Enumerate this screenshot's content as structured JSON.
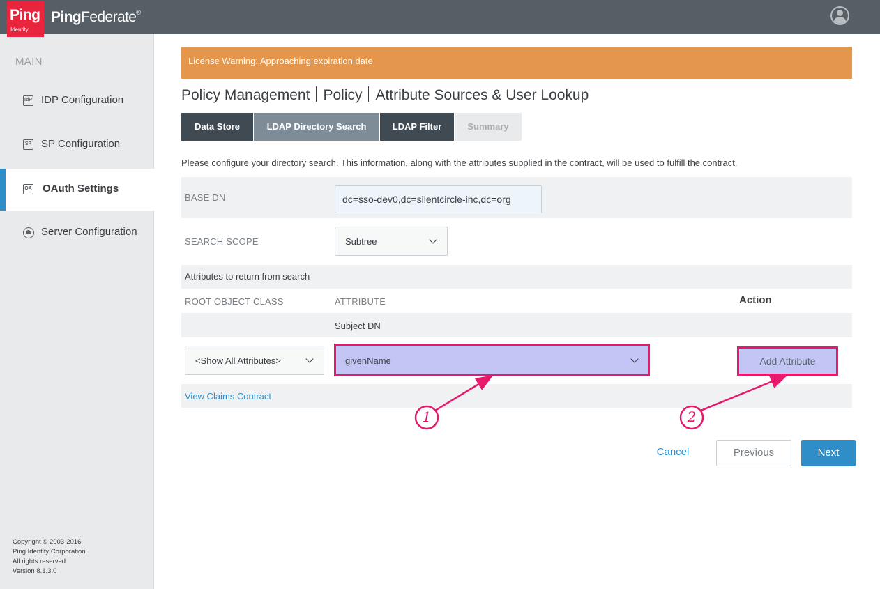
{
  "header": {
    "logo_text": "Ping",
    "logo_subtext": "Identity",
    "product_name_bold": "Ping",
    "product_name_rest": "Federate",
    "product_reg": "®",
    "user_icon": "user-avatar-icon"
  },
  "sidebar": {
    "section_title": "MAIN",
    "items": [
      {
        "label": "IDP Configuration",
        "icon_text": "IdP",
        "icon": "idp-icon",
        "active": false
      },
      {
        "label": "SP Configuration",
        "icon_text": "SP",
        "icon": "sp-icon",
        "active": false
      },
      {
        "label": "OAuth Settings",
        "icon_text": "OA",
        "icon": "oauth-icon",
        "active": true
      },
      {
        "label": "Server Configuration",
        "icon": "server-icon",
        "active": false
      }
    ],
    "footer": {
      "line1": "Copyright © 2003-2016",
      "line2": "Ping Identity Corporation",
      "line3": "All rights reserved",
      "line4": "Version 8.1.3.0"
    }
  },
  "banner": {
    "text": "License Warning: Approaching expiration date",
    "color": "#e4964d"
  },
  "breadcrumb": {
    "part1": "Policy Management",
    "part2": "Policy",
    "part3": "Attribute Sources & User Lookup"
  },
  "tabs": [
    {
      "label": "Data Store",
      "state": "done"
    },
    {
      "label": "LDAP Directory Search",
      "state": "current"
    },
    {
      "label": "LDAP Filter",
      "state": "done"
    },
    {
      "label": "Summary",
      "state": "todo"
    }
  ],
  "instructions": "Please configure your directory search. This information, along with the attributes supplied in the contract, will be used to fulfill the contract.",
  "form": {
    "base_dn_label": "BASE DN",
    "base_dn_value": "dc=sso-dev0,dc=silentcircle-inc,dc=org",
    "search_scope_label": "SEARCH SCOPE",
    "search_scope_value": "Subtree"
  },
  "attributes": {
    "section_title": "Attributes to return from search",
    "col_root": "ROOT OBJECT CLASS",
    "col_attribute": "ATTRIBUTE",
    "col_action": "Action",
    "rows": [
      {
        "attribute": "Subject DN"
      }
    ],
    "root_select_value": "<Show All Attributes>",
    "attribute_select_value": "givenName",
    "add_button": "Add Attribute"
  },
  "links": {
    "view_claims": "View Claims Contract"
  },
  "annotations": {
    "callout1": "1",
    "callout2": "2",
    "color": "#e8186c"
  },
  "footer_buttons": {
    "cancel": "Cancel",
    "previous": "Previous",
    "next": "Next"
  },
  "colors": {
    "topbar": "#575f66",
    "brand_red": "#e8253d",
    "accent_blue": "#2f8dc7",
    "tab_done": "#3f4a53",
    "tab_current": "#7e8c98"
  }
}
